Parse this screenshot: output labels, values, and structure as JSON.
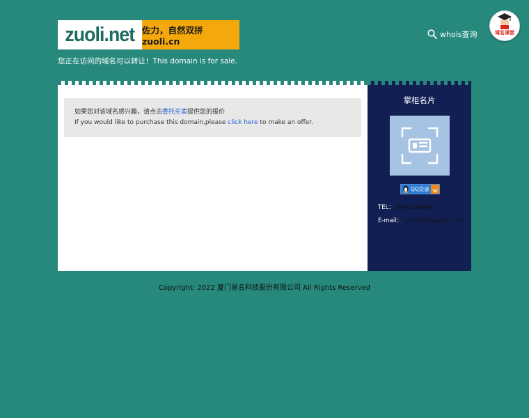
{
  "header": {
    "logo_name": "zuoli.net",
    "logo_slogan": "佐力，自然双拼zuoli.cn",
    "whois_label": "whois查询",
    "badge_label": "域名课堂"
  },
  "notice": "您正在访问的域名可以转让！This domain is for sale.",
  "main": {
    "info_cn_prefix": "如果您对该域名感兴趣，请点击",
    "info_cn_link": "委托买卖",
    "info_cn_suffix": "提供您的报价",
    "info_en_prefix": "If you would like to purchase this domain,please ",
    "info_en_link": "click here",
    "info_en_suffix": " to make an offer."
  },
  "card": {
    "title": "掌柜名片",
    "qq_label": "QQ交谈",
    "tel_label": "TEL：",
    "tel_value": "18702999899",
    "email_label": "E-mail：",
    "email_value": "ly571707@gmail.com"
  },
  "footer": {
    "copyright": "Copyright: 2022 厦门易名科技股份有限公司 All Rights Reserved"
  },
  "colors": {
    "background": "#27897c",
    "card_bg": "#121f53",
    "logo_accent": "#f4a80c",
    "link": "#1f5bd6"
  },
  "icons": [
    "search-icon",
    "graduation-cap-icon",
    "qr-placeholder-icon",
    "qq-penguin-icon"
  ]
}
